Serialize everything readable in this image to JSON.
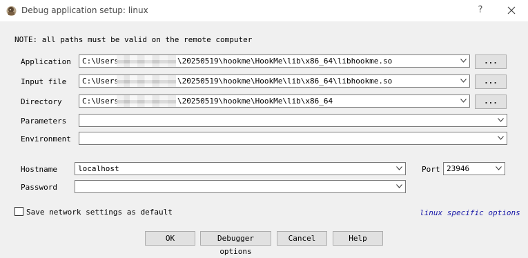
{
  "window": {
    "title": "Debug application setup: linux",
    "help_symbol": "?"
  },
  "note": "NOTE: all paths must be valid on the remote computer",
  "fields": {
    "application": {
      "label": "Application",
      "prefix": "C:\\Users",
      "suffix": "\\20250519\\hookme\\HookMe\\lib\\x86_64\\libhookme.so",
      "browse_label": "..."
    },
    "input_file": {
      "label": "Input file",
      "prefix": "C:\\Users",
      "suffix": "\\20250519\\hookme\\HookMe\\lib\\x86_64\\libhookme.so",
      "browse_label": "..."
    },
    "directory": {
      "label": "Directory",
      "prefix": "C:\\Users",
      "suffix": "\\20250519\\hookme\\HookMe\\lib\\x86_64",
      "browse_label": "..."
    },
    "parameters": {
      "label": "Parameters",
      "value": ""
    },
    "environment": {
      "label": "Environment",
      "value": ""
    }
  },
  "network": {
    "hostname_label": "Hostname",
    "hostname_value": "localhost",
    "port_label": "Port",
    "port_value": "23946",
    "password_label": "Password",
    "password_value": ""
  },
  "save_default": {
    "label": "Save network settings as default",
    "checked": false
  },
  "platform_link": "linux specific options",
  "buttons": {
    "ok": "OK",
    "debugger_options": "Debugger options",
    "cancel": "Cancel",
    "help": "Help"
  }
}
